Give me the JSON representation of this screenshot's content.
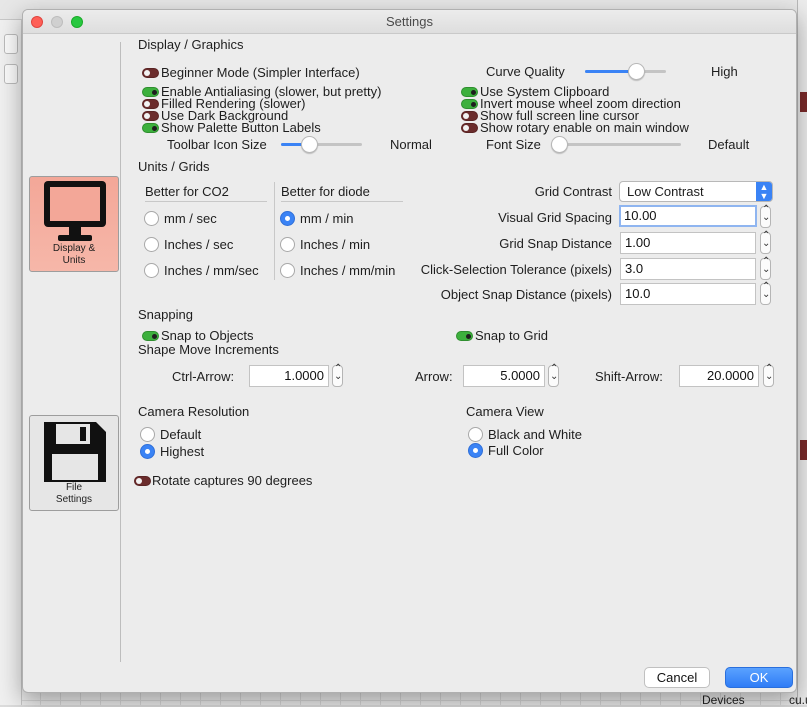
{
  "dialog": {
    "title": "Settings"
  },
  "sidebar": [
    {
      "label_line1": "Display &",
      "label_line2": "Units",
      "active": true
    },
    {
      "label_line1": "File",
      "label_line2": "Settings",
      "active": false
    }
  ],
  "display": {
    "section_title": "Display / Graphics",
    "toggles_left": [
      {
        "label": "Beginner Mode (Simpler Interface)",
        "on": false
      },
      {
        "label": "Enable Antialiasing (slower, but pretty)",
        "on": true
      },
      {
        "label": "Filled Rendering (slower)",
        "on": false
      },
      {
        "label": "Use Dark Background",
        "on": false
      },
      {
        "label": "Show Palette Button Labels",
        "on": true
      }
    ],
    "toggles_right": [
      {
        "label": "Use System Clipboard",
        "on": true
      },
      {
        "label": "Invert mouse wheel zoom direction",
        "on": true
      },
      {
        "label": "Show full screen line cursor",
        "on": false
      },
      {
        "label": "Show rotary enable on main window",
        "on": false
      }
    ],
    "curve_quality": {
      "label": "Curve Quality",
      "value_label": "High",
      "level": 0.72
    },
    "toolbar_icon_size": {
      "label": "Toolbar Icon Size",
      "value_label": "Normal",
      "level": 0.35
    },
    "font_size": {
      "label": "Font Size",
      "value_label": "Default",
      "level": 0.0
    }
  },
  "units": {
    "section_title": "Units / Grids",
    "co2_header": "Better for CO2",
    "diode_header": "Better for diode",
    "co2_options": [
      {
        "label": "mm / sec",
        "checked": false
      },
      {
        "label": "Inches / sec",
        "checked": false
      },
      {
        "label": "Inches / mm/sec",
        "checked": false
      }
    ],
    "diode_options": [
      {
        "label": "mm / min",
        "checked": true
      },
      {
        "label": "Inches / min",
        "checked": false
      },
      {
        "label": "Inches / mm/min",
        "checked": false
      }
    ],
    "grid_contrast": {
      "label": "Grid Contrast",
      "value": "Low Contrast"
    },
    "visual_grid_spacing": {
      "label": "Visual Grid Spacing",
      "value": "10.00"
    },
    "grid_snap_distance": {
      "label": "Grid Snap Distance",
      "value": "1.00"
    },
    "click_selection_tolerance": {
      "label": "Click-Selection Tolerance (pixels)",
      "value": "3.0"
    },
    "object_snap_distance": {
      "label": "Object Snap Distance (pixels)",
      "value": "10.0"
    }
  },
  "snapping": {
    "section_title": "Snapping",
    "snap_to_objects": {
      "label": "Snap to Objects",
      "on": true
    },
    "snap_to_grid": {
      "label": "Snap to Grid",
      "on": true
    },
    "increments_title": "Shape Move Increments",
    "ctrl_arrow": {
      "label": "Ctrl-Arrow:",
      "value": "1.0000"
    },
    "arrow": {
      "label": "Arrow:",
      "value": "5.0000"
    },
    "shift_arrow": {
      "label": "Shift-Arrow:",
      "value": "20.0000"
    }
  },
  "camera": {
    "resolution_title": "Camera Resolution",
    "resolution_options": [
      {
        "label": "Default",
        "checked": false
      },
      {
        "label": "Highest",
        "checked": true
      }
    ],
    "view_title": "Camera View",
    "view_options": [
      {
        "label": "Black and White",
        "checked": false
      },
      {
        "label": "Full Color",
        "checked": true
      }
    ],
    "rotate_captures": {
      "label": "Rotate captures 90 degrees",
      "on": false
    }
  },
  "buttons": {
    "cancel": "Cancel",
    "ok": "OK"
  },
  "background": {
    "bottom_label": "Devices",
    "bottom_label2": "cu.u"
  },
  "colors": {
    "accent": "#3a83f5",
    "toggle_on": "#3db03d",
    "toggle_off": "#6b2c2c",
    "active_tab": "#f3a798"
  }
}
